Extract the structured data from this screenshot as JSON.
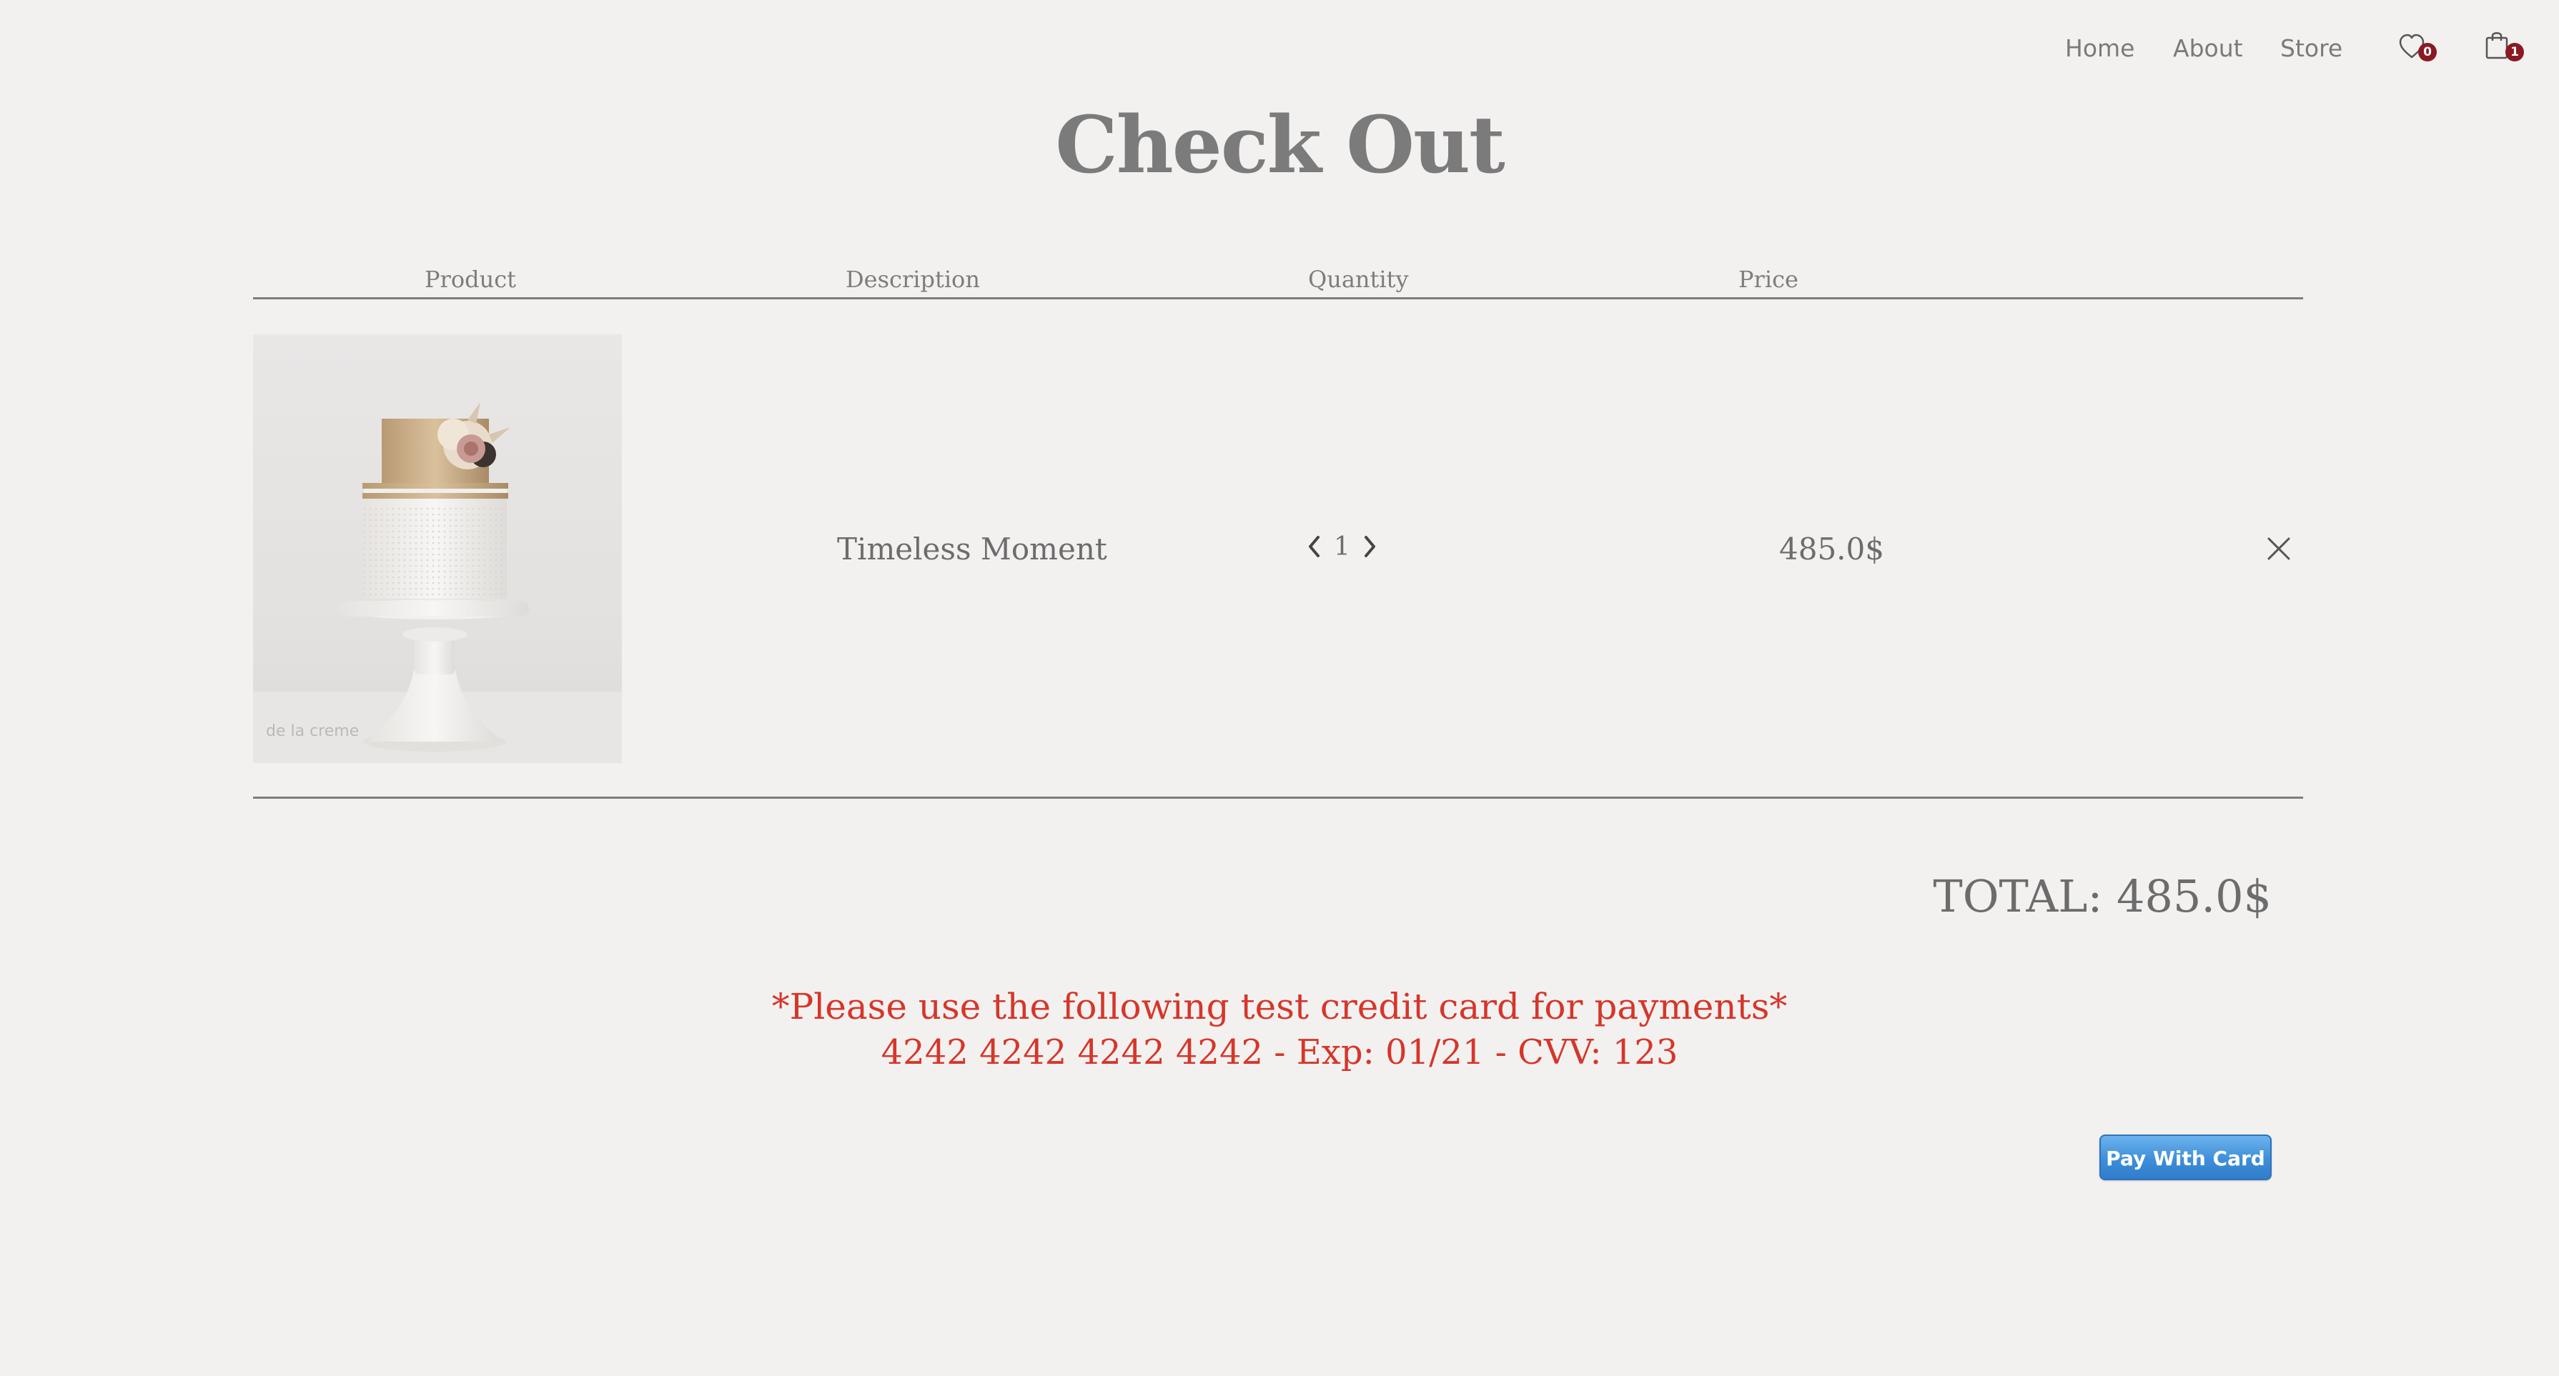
{
  "nav": {
    "links": [
      "Home",
      "About",
      "Store"
    ],
    "wishlist_count": "0",
    "cart_count": "1",
    "icons": {
      "wishlist": "heart-icon",
      "cart": "shopping-bag-icon"
    }
  },
  "page": {
    "title": "Check Out"
  },
  "table": {
    "headers": {
      "product": "Product",
      "description": "Description",
      "quantity": "Quantity",
      "price": "Price"
    },
    "items": [
      {
        "image": "wedding-cake-image",
        "image_watermark": "de la creme",
        "name": "Timeless Moment",
        "quantity": "1",
        "price": "485.0$"
      }
    ]
  },
  "total": {
    "label": "TOTAL: 485.0$"
  },
  "notice": {
    "line1": "*Please use the following test credit card for payments*",
    "line2": "4242 4242 4242 4242 - Exp: 01/21 - CVV: 123"
  },
  "pay": {
    "label": "Pay With Card"
  },
  "colors": {
    "background": "#f3f1f0",
    "text": "#6c6c6c",
    "notice": "#d6362a",
    "badge": "#8a1a22",
    "pay_button": "#3f8ed8"
  }
}
